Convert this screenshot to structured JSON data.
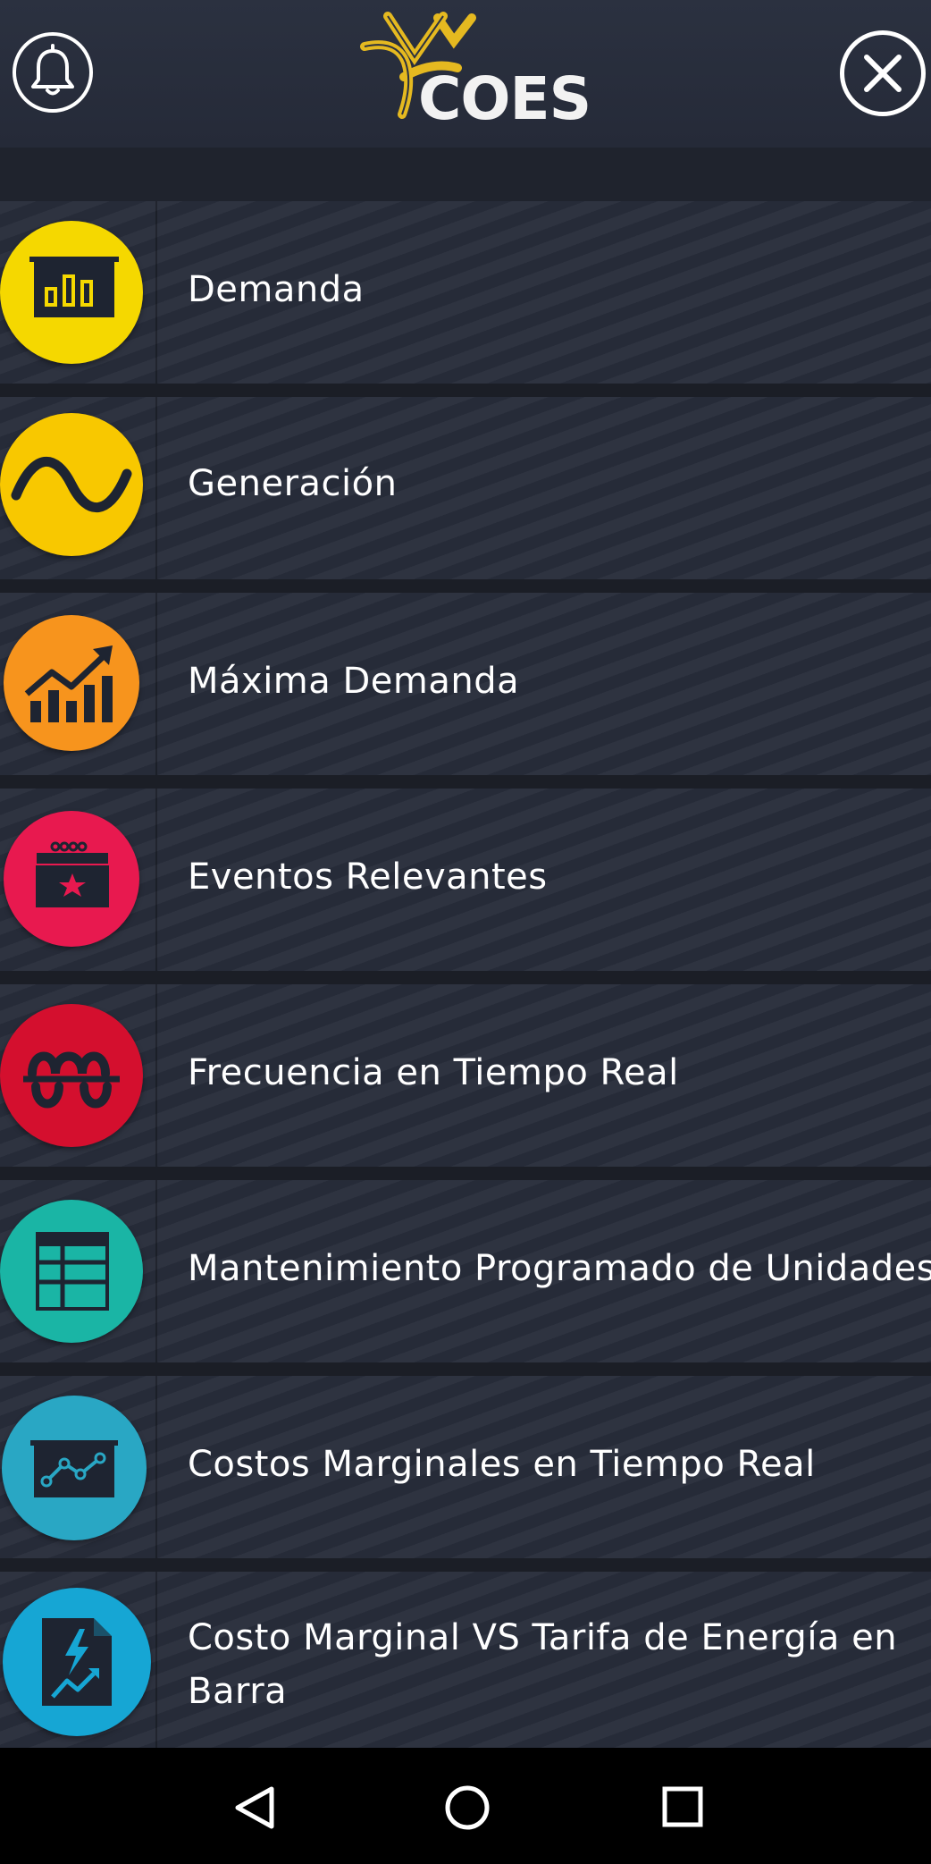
{
  "header": {
    "logo_text": "COES",
    "notification_icon": "bell-icon",
    "close_icon": "close-icon"
  },
  "menu": {
    "items": [
      {
        "label": "Demanda",
        "icon": "bar-chart-icon",
        "color": "#f5d800"
      },
      {
        "label": "Generación",
        "icon": "sine-wave-icon",
        "color": "#f8c800"
      },
      {
        "label": "Máxima Demanda",
        "icon": "trending-up-icon",
        "color": "#f7941d"
      },
      {
        "label": "Eventos Relevantes",
        "icon": "calendar-star-icon",
        "color": "#e8194f"
      },
      {
        "label": "Frecuencia en Tiempo Real",
        "icon": "frequency-icon",
        "color": "#d40f2e"
      },
      {
        "label": "Mantenimiento Programado de Unidades",
        "icon": "table-grid-icon",
        "color": "#1ab5a5"
      },
      {
        "label": "Costos Marginales en Tiempo Real",
        "icon": "line-chart-board-icon",
        "color": "#29a7c4"
      },
      {
        "label": "Costo Marginal VS Tarifa de Energía en Barra",
        "icon": "energy-document-icon",
        "color": "#16a6d4"
      }
    ]
  },
  "navbar": {
    "back_icon": "back-triangle-icon",
    "home_icon": "home-circle-icon",
    "recents_icon": "recents-square-icon"
  }
}
